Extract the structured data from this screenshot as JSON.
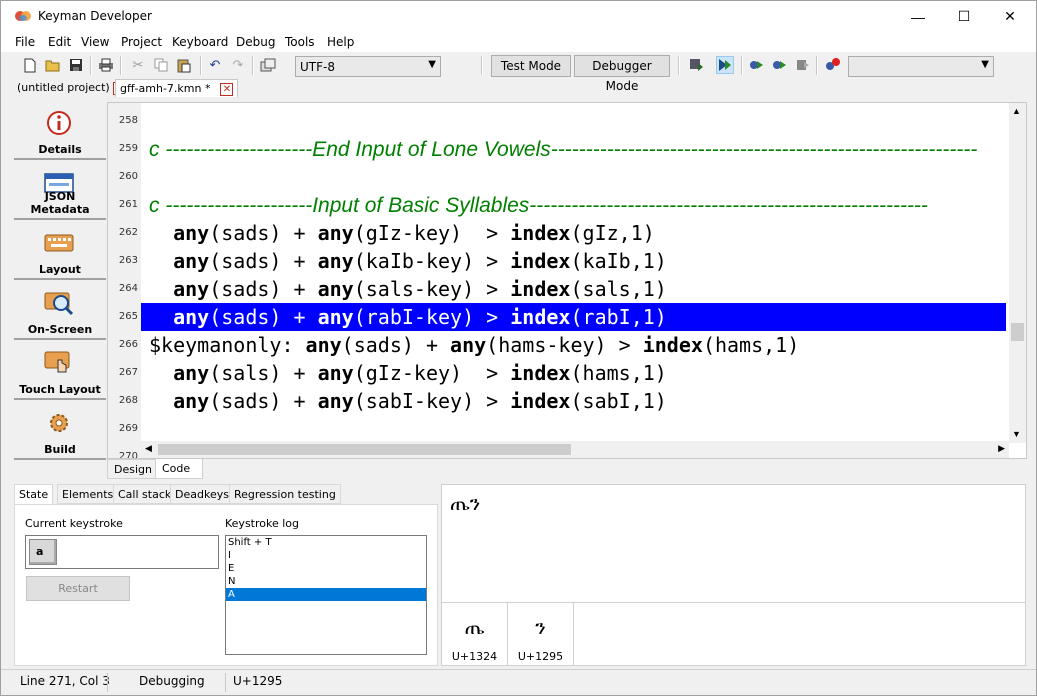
{
  "window": {
    "title": "Keyman Developer",
    "minimize": "—",
    "maximize": "☐",
    "close": "✕"
  },
  "menu": [
    "File",
    "Edit",
    "View",
    "Project",
    "Keyboard",
    "Debug",
    "Tools",
    "Help"
  ],
  "toolbar": {
    "encoding": "UTF-8",
    "test_mode": "Test Mode",
    "debugger_mode": "Debugger Mode",
    "empty_select": ""
  },
  "doc_tabs": [
    {
      "label": "(untitled project)",
      "close": "✕"
    },
    {
      "label": "gff-amh-7.kmn *",
      "close": "✕"
    }
  ],
  "side_nav": [
    {
      "label": "Details",
      "icon": "info-icon"
    },
    {
      "label": "JSON Metadata",
      "icon": "window-icon"
    },
    {
      "label": "Layout",
      "icon": "keyboard-icon"
    },
    {
      "label": "On-Screen",
      "icon": "magnify-keyboard-icon"
    },
    {
      "label": "Touch Layout",
      "icon": "touch-icon"
    },
    {
      "label": "Build",
      "icon": "gear-icon"
    }
  ],
  "editor": {
    "lines": [
      {
        "num": "258",
        "text": ""
      },
      {
        "num": "259",
        "text": "c ---------------------End Input of Lone Vowels-------------------------------------------------------------"
      },
      {
        "num": "260",
        "text": ""
      },
      {
        "num": "261",
        "text": "c ---------------------Input of Basic Syllables---------------------------------------------------------"
      },
      {
        "num": "262",
        "parts": [
          "  ",
          "any",
          "(sads) + ",
          "any",
          "(gIz-key)  > ",
          "index",
          "(gIz,1)"
        ]
      },
      {
        "num": "263",
        "parts": [
          "  ",
          "any",
          "(sads) + ",
          "any",
          "(kaIb-key) > ",
          "index",
          "(kaIb,1)"
        ]
      },
      {
        "num": "264",
        "parts": [
          "  ",
          "any",
          "(sads) + ",
          "any",
          "(sals-key) > ",
          "index",
          "(sals,1)"
        ]
      },
      {
        "num": "265",
        "parts": [
          "  ",
          "any",
          "(sads) + ",
          "any",
          "(rabI-key) > ",
          "index",
          "(rabI,1)"
        ]
      },
      {
        "num": "266",
        "parts": [
          "$keymanonly: ",
          "any",
          "(sads) + ",
          "any",
          "(hams-key) > ",
          "index",
          "(hams,1)"
        ]
      },
      {
        "num": "267",
        "parts": [
          "  ",
          "any",
          "(sals) + ",
          "any",
          "(gIz-key)  > ",
          "index",
          "(hams,1)"
        ]
      },
      {
        "num": "268",
        "parts": [
          "  ",
          "any",
          "(sads) + ",
          "any",
          "(sabI-key) > ",
          "index",
          "(sabI,1)"
        ]
      },
      {
        "num": "269",
        "text": ""
      },
      {
        "num": "270",
        "text": ""
      }
    ],
    "tabs": [
      "Design",
      "Code"
    ]
  },
  "debug": {
    "tabs": [
      "State",
      "Elements",
      "Call stack",
      "Deadkeys",
      "Regression testing"
    ],
    "current_keystroke_label": "Current keystroke",
    "current_key": "a",
    "restart": "Restart",
    "log_label": "Keystroke log",
    "log": [
      "Shift + T",
      "I",
      "E",
      "N",
      "A"
    ],
    "selected_log_index": 4
  },
  "output": {
    "text": "ጤን",
    "chars": [
      {
        "glyph": "ጤ",
        "code": "U+1324"
      },
      {
        "glyph": "ን",
        "code": "U+1295"
      }
    ]
  },
  "status": {
    "position": "Line 271, Col 3",
    "mode": "Debugging",
    "char": "U+1295"
  },
  "colors": {
    "comment": "#008000",
    "highlight": "#0000ff",
    "selection": "#0078d7"
  }
}
